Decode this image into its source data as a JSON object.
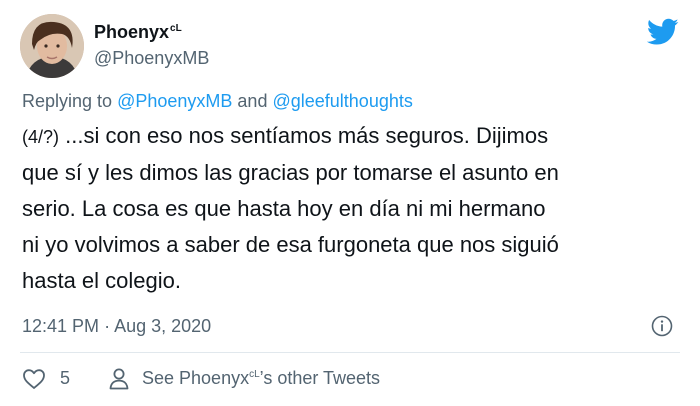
{
  "author": {
    "name": "Phoenyx",
    "name_superscript": "cL",
    "handle": "@PhoenyxMB"
  },
  "reply": {
    "prefix": "Replying to",
    "mention1": "@PhoenyxMB",
    "joiner": "and",
    "mention2": "@gleefulthoughts"
  },
  "tweet": {
    "prefix": "(4/?)",
    "line1": "...si con eso nos sentíamos más seguros. Dijimos",
    "line2": "que sí y les dimos las gracias por tomarse el asunto en",
    "line3": "serio. La cosa es que hasta hoy en día ni mi hermano",
    "line4": "ni yo volvimos a saber de esa furgoneta que nos siguió",
    "line5": "hasta el colegio."
  },
  "meta": {
    "time": "12:41 PM",
    "separator": "·",
    "date": "Aug 3, 2020"
  },
  "actions": {
    "like_count": "5",
    "see_other_prefix": "See Phoenyx",
    "see_other_superscript": "cL",
    "see_other_suffix": "’s other Tweets"
  },
  "icons": {
    "brand": "twitter-bird-icon",
    "info": "info-icon",
    "like": "heart-icon",
    "profile": "person-icon"
  },
  "colors": {
    "text": "#0f1419",
    "secondary": "#536471",
    "link": "#1d9bf0",
    "divider": "#e1e8ed"
  }
}
